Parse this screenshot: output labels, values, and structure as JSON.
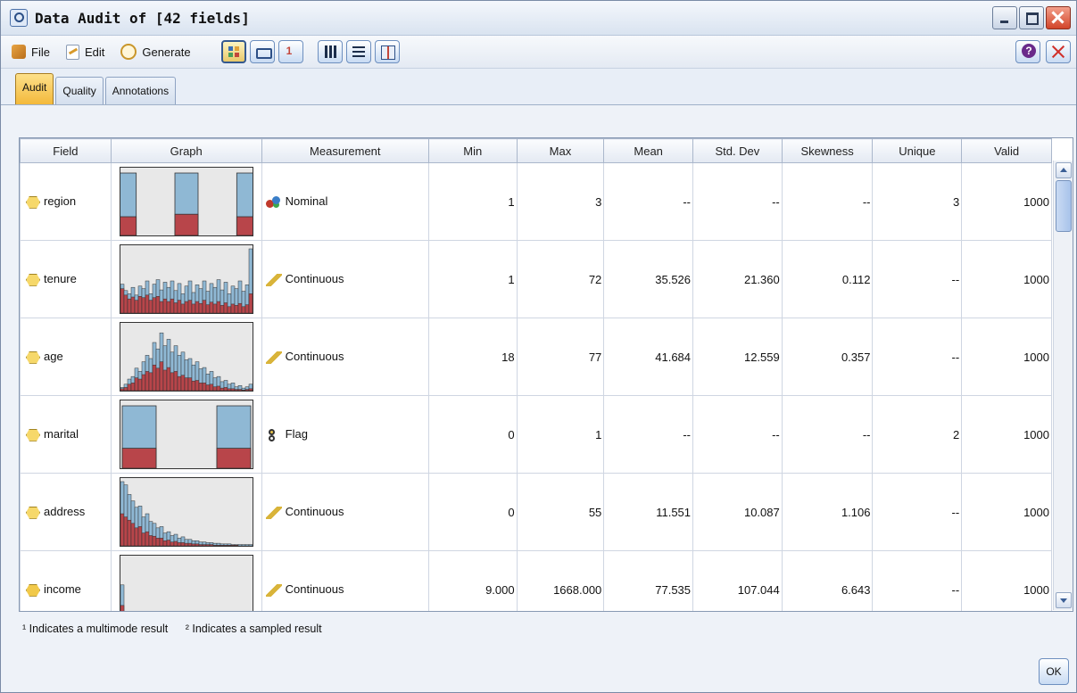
{
  "window": {
    "title": "Data Audit of [42 fields]"
  },
  "toolbar": {
    "menus": [
      {
        "label": "File",
        "icon": "file-icon"
      },
      {
        "label": "Edit",
        "icon": "edit-icon"
      },
      {
        "label": "Generate",
        "icon": "generate-icon"
      }
    ]
  },
  "tabs": [
    {
      "label": "Audit",
      "active": true
    },
    {
      "label": "Quality",
      "active": false
    },
    {
      "label": "Annotations",
      "active": false
    }
  ],
  "table": {
    "columns": [
      "Field",
      "Graph",
      "Measurement",
      "Min",
      "Max",
      "Mean",
      "Std. Dev",
      "Skewness",
      "Unique",
      "Valid"
    ],
    "rows": [
      {
        "field": "region",
        "measurement": "Nominal",
        "mtype": "nominal",
        "min": "1",
        "max": "3",
        "mean": "--",
        "std": "--",
        "skew": "--",
        "unique": "3",
        "valid": "1000",
        "graph": {
          "kind": "categorical",
          "bars": [
            [
              1.0,
              0.3
            ],
            [
              1.0,
              0.34
            ],
            [
              1.0,
              0.3
            ]
          ]
        }
      },
      {
        "field": "tenure",
        "measurement": "Continuous",
        "mtype": "continuous",
        "min": "1",
        "max": "72",
        "mean": "35.526",
        "std": "21.360",
        "skew": "0.112",
        "unique": "--",
        "valid": "1000",
        "graph": {
          "kind": "histogram",
          "bars": [
            [
              0.45,
              0.38
            ],
            [
              0.35,
              0.28
            ],
            [
              0.3,
              0.22
            ],
            [
              0.4,
              0.25
            ],
            [
              0.28,
              0.2
            ],
            [
              0.42,
              0.26
            ],
            [
              0.38,
              0.24
            ],
            [
              0.5,
              0.28
            ],
            [
              0.3,
              0.2
            ],
            [
              0.45,
              0.24
            ],
            [
              0.52,
              0.26
            ],
            [
              0.36,
              0.18
            ],
            [
              0.48,
              0.22
            ],
            [
              0.4,
              0.18
            ],
            [
              0.5,
              0.22
            ],
            [
              0.35,
              0.16
            ],
            [
              0.46,
              0.2
            ],
            [
              0.3,
              0.14
            ],
            [
              0.42,
              0.18
            ],
            [
              0.5,
              0.2
            ],
            [
              0.32,
              0.14
            ],
            [
              0.44,
              0.18
            ],
            [
              0.38,
              0.15
            ],
            [
              0.5,
              0.2
            ],
            [
              0.34,
              0.13
            ],
            [
              0.46,
              0.17
            ],
            [
              0.4,
              0.14
            ],
            [
              0.52,
              0.18
            ],
            [
              0.36,
              0.12
            ],
            [
              0.48,
              0.16
            ],
            [
              0.3,
              0.1
            ],
            [
              0.42,
              0.14
            ],
            [
              0.38,
              0.12
            ],
            [
              0.5,
              0.15
            ],
            [
              0.34,
              0.1
            ],
            [
              0.44,
              0.13
            ],
            [
              1.0,
              0.3
            ]
          ]
        }
      },
      {
        "field": "age",
        "measurement": "Continuous",
        "mtype": "continuous",
        "min": "18",
        "max": "77",
        "mean": "41.684",
        "std": "12.559",
        "skew": "0.357",
        "unique": "--",
        "valid": "1000",
        "graph": {
          "kind": "histogram",
          "bars": [
            [
              0.05,
              0.03
            ],
            [
              0.1,
              0.05
            ],
            [
              0.18,
              0.1
            ],
            [
              0.22,
              0.12
            ],
            [
              0.35,
              0.2
            ],
            [
              0.3,
              0.18
            ],
            [
              0.45,
              0.25
            ],
            [
              0.55,
              0.3
            ],
            [
              0.5,
              0.28
            ],
            [
              0.75,
              0.4
            ],
            [
              0.65,
              0.35
            ],
            [
              0.9,
              0.45
            ],
            [
              0.7,
              0.32
            ],
            [
              0.8,
              0.36
            ],
            [
              0.6,
              0.28
            ],
            [
              0.7,
              0.3
            ],
            [
              0.55,
              0.22
            ],
            [
              0.6,
              0.24
            ],
            [
              0.48,
              0.2
            ],
            [
              0.5,
              0.2
            ],
            [
              0.4,
              0.15
            ],
            [
              0.45,
              0.16
            ],
            [
              0.34,
              0.12
            ],
            [
              0.36,
              0.12
            ],
            [
              0.26,
              0.09
            ],
            [
              0.3,
              0.1
            ],
            [
              0.2,
              0.06
            ],
            [
              0.22,
              0.07
            ],
            [
              0.14,
              0.04
            ],
            [
              0.16,
              0.05
            ],
            [
              0.1,
              0.03
            ],
            [
              0.12,
              0.03
            ],
            [
              0.06,
              0.02
            ],
            [
              0.08,
              0.02
            ],
            [
              0.04,
              0.01
            ],
            [
              0.06,
              0.02
            ],
            [
              0.1,
              0.03
            ]
          ]
        }
      },
      {
        "field": "marital",
        "measurement": "Flag",
        "mtype": "flag",
        "min": "0",
        "max": "1",
        "mean": "--",
        "std": "--",
        "skew": "--",
        "unique": "2",
        "valid": "1000",
        "graph": {
          "kind": "categorical",
          "bars": [
            [
              1.0,
              0.32
            ],
            [
              1.0,
              0.32
            ]
          ]
        }
      },
      {
        "field": "address",
        "measurement": "Continuous",
        "mtype": "continuous",
        "min": "0",
        "max": "55",
        "mean": "11.551",
        "std": "10.087",
        "skew": "1.106",
        "unique": "--",
        "valid": "1000",
        "graph": {
          "kind": "histogram",
          "bars": [
            [
              1.0,
              0.5
            ],
            [
              0.95,
              0.45
            ],
            [
              0.8,
              0.4
            ],
            [
              0.7,
              0.35
            ],
            [
              0.6,
              0.28
            ],
            [
              0.62,
              0.3
            ],
            [
              0.45,
              0.2
            ],
            [
              0.5,
              0.22
            ],
            [
              0.38,
              0.16
            ],
            [
              0.35,
              0.15
            ],
            [
              0.28,
              0.12
            ],
            [
              0.3,
              0.12
            ],
            [
              0.2,
              0.08
            ],
            [
              0.22,
              0.09
            ],
            [
              0.16,
              0.06
            ],
            [
              0.18,
              0.07
            ],
            [
              0.12,
              0.05
            ],
            [
              0.14,
              0.05
            ],
            [
              0.1,
              0.04
            ],
            [
              0.1,
              0.04
            ],
            [
              0.08,
              0.03
            ],
            [
              0.08,
              0.03
            ],
            [
              0.06,
              0.02
            ],
            [
              0.06,
              0.02
            ],
            [
              0.05,
              0.02
            ],
            [
              0.05,
              0.02
            ],
            [
              0.04,
              0.01
            ],
            [
              0.04,
              0.01
            ],
            [
              0.03,
              0.01
            ],
            [
              0.03,
              0.01
            ],
            [
              0.03,
              0.01
            ],
            [
              0.02,
              0.01
            ],
            [
              0.02,
              0.01
            ],
            [
              0.02,
              0.0
            ],
            [
              0.02,
              0.0
            ],
            [
              0.02,
              0.0
            ],
            [
              0.02,
              0.0
            ]
          ]
        }
      },
      {
        "field": "income",
        "measurement": "Continuous",
        "mtype": "hash",
        "min": "9.000",
        "max": "1668.000",
        "mean": "77.535",
        "std": "107.044",
        "skew": "6.643",
        "unique": "--",
        "valid": "1000",
        "graph": {
          "kind": "histogram",
          "bars": [
            [
              0.6,
              0.28
            ],
            [
              0.15,
              0.08
            ],
            [
              0.06,
              0.03
            ],
            [
              0.04,
              0.02
            ],
            [
              0.02,
              0.01
            ],
            [
              0.02,
              0.01
            ],
            [
              0.02,
              0.01
            ],
            [
              0.01,
              0.0
            ],
            [
              0.02,
              0.0
            ],
            [
              0.01,
              0.0
            ],
            [
              0.01,
              0.0
            ],
            [
              0.01,
              0.0
            ],
            [
              0.0,
              0.0
            ],
            [
              0.01,
              0.0
            ],
            [
              0.0,
              0.0
            ],
            [
              0.01,
              0.0
            ],
            [
              0.0,
              0.0
            ],
            [
              0.0,
              0.0
            ],
            [
              0.0,
              0.0
            ],
            [
              0.01,
              0.0
            ],
            [
              0.0,
              0.0
            ],
            [
              0.0,
              0.0
            ],
            [
              0.0,
              0.0
            ],
            [
              0.0,
              0.0
            ],
            [
              0.01,
              0.0
            ],
            [
              0.0,
              0.0
            ],
            [
              0.0,
              0.0
            ],
            [
              0.0,
              0.0
            ],
            [
              0.0,
              0.0
            ],
            [
              0.0,
              0.0
            ],
            [
              0.0,
              0.0
            ],
            [
              0.0,
              0.0
            ],
            [
              0.0,
              0.0
            ],
            [
              0.0,
              0.0
            ],
            [
              0.0,
              0.0
            ],
            [
              0.0,
              0.0
            ],
            [
              0.02,
              0.0
            ]
          ]
        }
      }
    ]
  },
  "footnotes": [
    "¹ Indicates a multimode result",
    "² Indicates a sampled result"
  ],
  "ok_label": "OK",
  "colors": {
    "bar_blue": "#8fb8d4",
    "bar_red": "#b8454a",
    "graph_bg": "#e8e8e8"
  }
}
